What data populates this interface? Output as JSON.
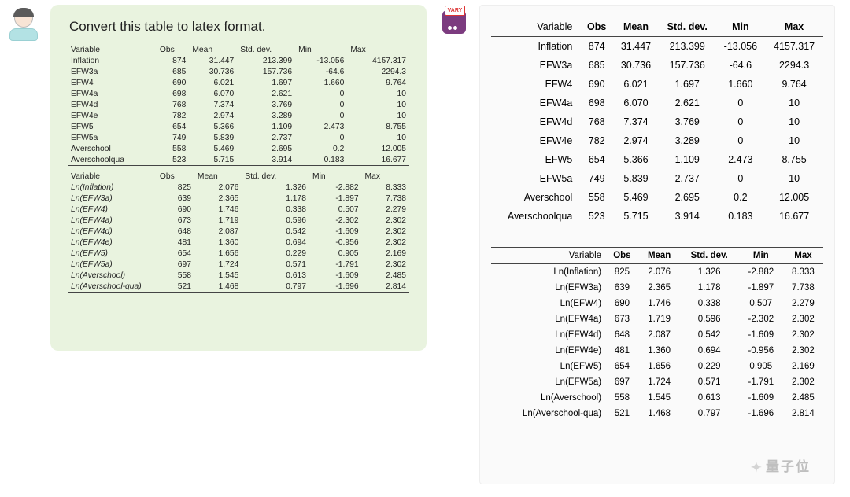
{
  "prompt": "Convert this table to latex format.",
  "bot_badge": "VARY",
  "watermark": "量子位",
  "columns": [
    "Variable",
    "Obs",
    "Mean",
    "Std. dev.",
    "Min",
    "Max"
  ],
  "chart_data": [
    {
      "type": "table",
      "title": "Descriptive statistics (levels)",
      "columns": [
        "Variable",
        "Obs",
        "Mean",
        "Std. dev.",
        "Min",
        "Max"
      ],
      "rows": [
        [
          "Inflation",
          "874",
          "31.447",
          "213.399",
          "-13.056",
          "4157.317"
        ],
        [
          "EFW3a",
          "685",
          "30.736",
          "157.736",
          "-64.6",
          "2294.3"
        ],
        [
          "EFW4",
          "690",
          "6.021",
          "1.697",
          "1.660",
          "9.764"
        ],
        [
          "EFW4a",
          "698",
          "6.070",
          "2.621",
          "0",
          "10"
        ],
        [
          "EFW4d",
          "768",
          "7.374",
          "3.769",
          "0",
          "10"
        ],
        [
          "EFW4e",
          "782",
          "2.974",
          "3.289",
          "0",
          "10"
        ],
        [
          "EFW5",
          "654",
          "5.366",
          "1.109",
          "2.473",
          "8.755"
        ],
        [
          "EFW5a",
          "749",
          "5.839",
          "2.737",
          "0",
          "10"
        ],
        [
          "Averschool",
          "558",
          "5.469",
          "2.695",
          "0.2",
          "12.005"
        ],
        [
          "Averschoolqua",
          "523",
          "5.715",
          "3.914",
          "0.183",
          "16.677"
        ]
      ]
    },
    {
      "type": "table",
      "title": "Descriptive statistics (logs)",
      "columns": [
        "Variable",
        "Obs",
        "Mean",
        "Std. dev.",
        "Min",
        "Max"
      ],
      "rows": [
        [
          "Ln(Inflation)",
          "825",
          "2.076",
          "1.326",
          "-2.882",
          "8.333"
        ],
        [
          "Ln(EFW3a)",
          "639",
          "2.365",
          "1.178",
          "-1.897",
          "7.738"
        ],
        [
          "Ln(EFW4)",
          "690",
          "1.746",
          "0.338",
          "0.507",
          "2.279"
        ],
        [
          "Ln(EFW4a)",
          "673",
          "1.719",
          "0.596",
          "-2.302",
          "2.302"
        ],
        [
          "Ln(EFW4d)",
          "648",
          "2.087",
          "0.542",
          "-1.609",
          "2.302"
        ],
        [
          "Ln(EFW4e)",
          "481",
          "1.360",
          "0.694",
          "-0.956",
          "2.302"
        ],
        [
          "Ln(EFW5)",
          "654",
          "1.656",
          "0.229",
          "0.905",
          "2.169"
        ],
        [
          "Ln(EFW5a)",
          "697",
          "1.724",
          "0.571",
          "-1.791",
          "2.302"
        ],
        [
          "Ln(Averschool)",
          "558",
          "1.545",
          "0.613",
          "-1.609",
          "2.485"
        ],
        [
          "Ln(Averschool-qua)",
          "521",
          "1.468",
          "0.797",
          "-1.696",
          "2.814"
        ]
      ]
    }
  ]
}
